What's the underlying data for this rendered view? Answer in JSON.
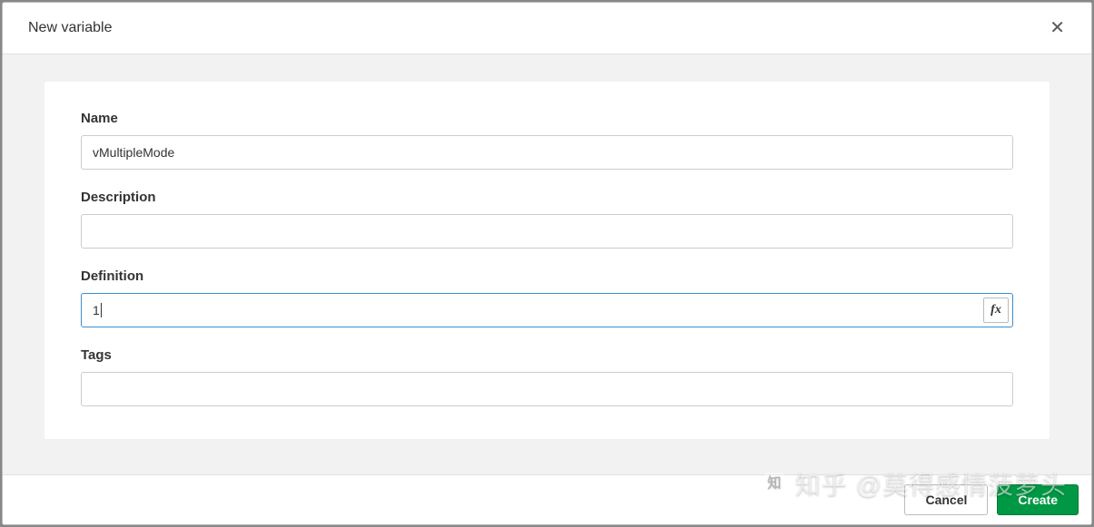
{
  "modal": {
    "title": "New variable",
    "close_icon": "✕"
  },
  "form": {
    "name": {
      "label": "Name",
      "value": "vMultipleMode"
    },
    "description": {
      "label": "Description",
      "value": ""
    },
    "definition": {
      "label": "Definition",
      "value": "1",
      "fx_label": "fx"
    },
    "tags": {
      "label": "Tags",
      "value": ""
    }
  },
  "footer": {
    "cancel_label": "Cancel",
    "create_label": "Create"
  },
  "watermark": {
    "text": "知乎 @莫得感情菠萝头"
  }
}
